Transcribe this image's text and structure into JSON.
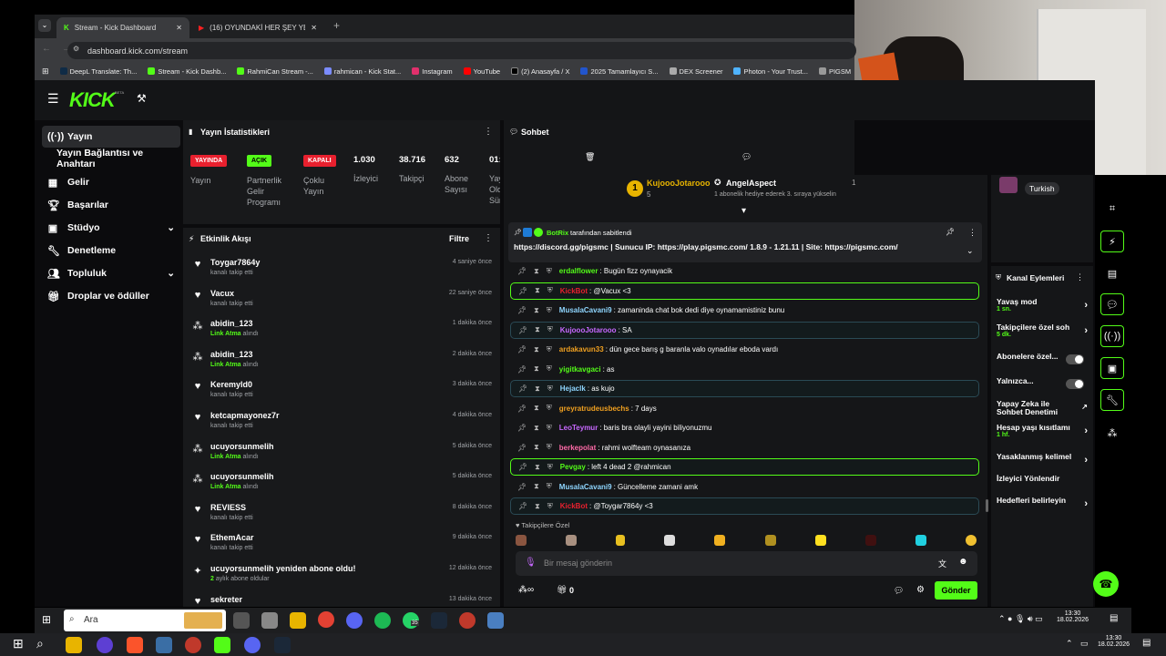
{
  "browser": {
    "tabs": [
      {
        "label": "Stream - Kick Dashboard",
        "active": true
      },
      {
        "label": "(16) OYUNDAKİ HER ŞEY YENİL..."
      }
    ],
    "url": "dashboard.kick.com/stream",
    "bookmarks": [
      "DeepL Translate: Th...",
      "Stream - Kick Dashb...",
      "RahmiCan Stream -...",
      "rahmican - Kick Stat...",
      "Instagram",
      "YouTube",
      "(2) Anasayfa / X",
      "2025 Tamamlayıcı S...",
      "DEX Screener",
      "Photon - Your Trust...",
      "PIGSM"
    ]
  },
  "logo": {
    "text": "KICK",
    "beta": "BETA"
  },
  "sidebar": {
    "items": [
      {
        "label": "Yayın",
        "icon": "broadcast-icon",
        "active": true
      },
      {
        "label": "Yayın Bağlantısı ve Anahtarı",
        "icon": ""
      },
      {
        "label": "Gelir",
        "icon": "revenue-icon"
      },
      {
        "label": "Başarılar",
        "icon": "trophy-icon"
      },
      {
        "label": "Stüdyo",
        "icon": "studio-icon",
        "expand": true
      },
      {
        "label": "Denetleme",
        "icon": "wrench-icon"
      },
      {
        "label": "Topluluk",
        "icon": "community-icon",
        "expand": true
      },
      {
        "label": "Droplar ve ödüller",
        "icon": "gift-icon"
      }
    ]
  },
  "stats": {
    "title": "Yayın İstatistikleri",
    "items": [
      {
        "badge": "YAYINDA",
        "label": "Yayın",
        "badge_color": "#e8202e"
      },
      {
        "badge": "AÇIK",
        "label": "Partnerlik Gelir Programı",
        "badge_color": "#53fc18"
      },
      {
        "badge": "KAPALI",
        "label": "Çoklu Yayın",
        "badge_color": "#e8202e"
      },
      {
        "value": "1.030",
        "label": "İzleyici"
      },
      {
        "value": "38.716",
        "label": "Takipçi"
      },
      {
        "value": "632",
        "label": "Abone Sayısı"
      },
      {
        "value": "01:",
        "label": "Yay Old Sür"
      }
    ]
  },
  "activity": {
    "title": "Etkinlik Akışı",
    "filter": "Filtre",
    "events": [
      {
        "name": "Toygar7864y",
        "sub": "kanalı takip etti",
        "time": "4 saniye önce",
        "kind": "follow"
      },
      {
        "name": "Vacux",
        "sub": "kanalı takip etti",
        "time": "22 saniye önce",
        "kind": "follow"
      },
      {
        "name": "abidin_123",
        "highlight": "Link Atma",
        "sub": "alındı",
        "time": "1 dakika önce",
        "kind": "redeem"
      },
      {
        "name": "abidin_123",
        "highlight": "Link Atma",
        "sub": "alındı",
        "time": "2 dakika önce",
        "kind": "redeem"
      },
      {
        "name": "Keremyld0",
        "sub": "kanalı takip etti",
        "time": "3 dakika önce",
        "kind": "follow"
      },
      {
        "name": "ketcapmayonez7r",
        "sub": "kanalı takip etti",
        "time": "4 dakika önce",
        "kind": "follow"
      },
      {
        "name": "ucuyorsunmelih",
        "highlight": "Link Atma",
        "sub": "alındı",
        "time": "5 dakika önce",
        "kind": "redeem"
      },
      {
        "name": "ucuyorsunmelih",
        "highlight": "Link Atma",
        "sub": "alındı",
        "time": "5 dakika önce",
        "kind": "redeem"
      },
      {
        "name": "REVIESS",
        "sub": "kanalı takip etti",
        "time": "8 dakika önce",
        "kind": "follow"
      },
      {
        "name": "EthemAcar",
        "sub": "kanalı takip etti",
        "time": "9 dakika önce",
        "kind": "follow"
      },
      {
        "name": "ucuyorsunmelih yeniden abone oldu!",
        "highlight": "2",
        "sub": "aylık abone oldular",
        "time": "12 dakika önce",
        "kind": "sub"
      },
      {
        "name": "sekreter",
        "sub": "",
        "time": "13 dakika önce",
        "kind": "follow"
      }
    ]
  },
  "chat": {
    "title": "Sohbet",
    "top_users": [
      {
        "name": "KujoooJotarooo",
        "rank": "1",
        "count": "5"
      },
      {
        "name": "AngelAspect",
        "note": "1 abonelik hediye ederek 3. sıraya yükselin",
        "count": "1"
      }
    ],
    "pinned": {
      "by": "BotRix",
      "text_by": "tarafından sabitlendi",
      "content": "https://discord.gg/pigsmc | Sunucu IP: https://play.pigsmc.com/ 1.8.9 - 1.21.11 | Site: https://pigsmc.com/"
    },
    "messages": [
      {
        "user": "erdalflower",
        "text": ": Bugün fizz oynayacik",
        "color": "#53fc18",
        "style": ""
      },
      {
        "user": "KickBot",
        "text": ": @Vacux <3",
        "color": "#e8202e",
        "style": "hl"
      },
      {
        "user": "MusalaCavani9",
        "text": ": zamaninda chat bok dedi diye oynamamistiniz bunu",
        "color": "#8fd6ff",
        "style": ""
      },
      {
        "user": "KujoooJotarooo",
        "text": ": SA",
        "color": "#c768ff",
        "style": "blue"
      },
      {
        "user": "ardakavun33",
        "text": ": dün gece barış g baranla valo oynadılar eboda vardı",
        "color": "#f0a020",
        "style": ""
      },
      {
        "user": "yigitkavgaci",
        "text": ": as",
        "color": "#53fc18",
        "style": ""
      },
      {
        "user": "Hejaclk",
        "text": ": as kujo",
        "color": "#8fd6ff",
        "style": "blue"
      },
      {
        "user": "greyratrudeusbechs",
        "text": ": 7 days",
        "color": "#f0a020",
        "style": ""
      },
      {
        "user": "LeoTeymur",
        "text": ": baris bra olayli yayini biliyonuzmu",
        "color": "#c768ff",
        "style": ""
      },
      {
        "user": "berkepolat",
        "text": ": rahmi wolfteam oynasanıza",
        "color": "#ff6aa8",
        "style": ""
      },
      {
        "user": "Pevgay",
        "text": ": left 4 dead 2 @rahmican",
        "color": "#53fc18",
        "style": "hl"
      },
      {
        "user": "MusalaCavani9",
        "text": ": Güncelleme zamani amk",
        "color": "#8fd6ff",
        "style": ""
      },
      {
        "user": "KickBot",
        "text": ": @Toygar7864y <3",
        "color": "#e8202e",
        "style": "blue"
      }
    ],
    "followers_only": "Takipçilere Özel",
    "input_placeholder": "Bir mesaj gönderin",
    "points": "0",
    "send": "Gönder"
  },
  "channel_actions": {
    "title": "Kanal Eylemleri",
    "language": "Turkish",
    "items": [
      {
        "label": "Yavaş mod",
        "sub": "1 sn.",
        "control": "chevron"
      },
      {
        "label": "Takipçilere özel soh",
        "sub": "5 dk.",
        "control": "chevron"
      },
      {
        "label": "Abonelere özel...",
        "control": "toggle"
      },
      {
        "label": "Yalnızca...",
        "control": "toggle"
      },
      {
        "label": "Yapay Zeka ile Sohbet Denetimi",
        "control": "external"
      },
      {
        "label": "Hesap yaşı kısıtlamı",
        "sub": "1 hf.",
        "control": "chevron"
      },
      {
        "label": "Yasaklanmış kelimel",
        "control": "chevron"
      },
      {
        "label": "İzleyici Yönlendir",
        "control": ""
      },
      {
        "label": "Hedefleri belirleyin",
        "control": "chevron"
      }
    ]
  },
  "taskbar": {
    "search": "Ara",
    "time": "13:30",
    "date": "18.02.2026",
    "badge": "35"
  },
  "colors": {
    "accent": "#53fc18",
    "live": "#e8202e",
    "panel": "#18191b"
  }
}
